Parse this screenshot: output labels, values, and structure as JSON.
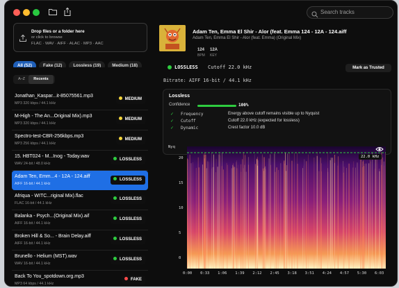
{
  "search": {
    "placeholder": "Search tracks"
  },
  "drop_zone": {
    "line1": "Drop files or a folder here",
    "line2": "or click to browse",
    "line3": "FLAC · WAV · AIFF · ALAC · MP3 · AAC"
  },
  "filters": [
    "All (52)",
    "Fake (12)",
    "Lossless (19)",
    "Medium (18)"
  ],
  "sort": {
    "az": "A–Z",
    "recent": "Recents"
  },
  "colors": {
    "accent": "#1f6fe5",
    "lossless": "#2ecc40",
    "medium": "#f5d63d",
    "fake": "#ff4b4b"
  },
  "tracks": [
    {
      "name": "Jonathan_Kaspar...it-85075561.mp3",
      "meta": "MP3 320 kbps / 44.1 kHz",
      "badge": "MEDIUM",
      "color": "#f5d63d"
    },
    {
      "name": "M-High - The An...Original Mix).mp3",
      "meta": "MP3 320 kbps / 44.1 kHz",
      "badge": "MEDIUM",
      "color": "#f5d63d"
    },
    {
      "name": "Spectro-test-CBR-256kbps.mp3",
      "meta": "MP3 256 kbps / 44.1 kHz",
      "badge": "MEDIUM",
      "color": "#f5d63d"
    },
    {
      "name": "15. HBT024 - M...Inog - Today.wav",
      "meta": "WAV 24-bit / 48.0 kHz",
      "badge": "LOSSLESS",
      "color": "#2ecc40"
    },
    {
      "name": "Adam Ten, Emm...4 - 12A - 124.aiff",
      "meta": "AIFF 16-bit / 44.1 kHz",
      "badge": "LOSSLESS",
      "color": "#2ecc40",
      "selected": true
    },
    {
      "name": "Afriqua - WITC...riginal Mix).flac",
      "meta": "FLAC 16-bit / 44.1 kHz",
      "badge": "LOSSLESS",
      "color": "#2ecc40"
    },
    {
      "name": "Balanka - Psych...(Original Mix).aif",
      "meta": "AIFF 16-bit / 44.1 kHz",
      "badge": "LOSSLESS",
      "color": "#2ecc40"
    },
    {
      "name": "Broken Hill & So... - Brain Delay.aiff",
      "meta": "AIFF 16-bit / 44.1 kHz",
      "badge": "LOSSLESS",
      "color": "#2ecc40"
    },
    {
      "name": "Brunello - Helium (MST).wav",
      "meta": "WAV 16-bit / 44.1 kHz",
      "badge": "LOSSLESS",
      "color": "#2ecc40"
    },
    {
      "name": "Back To You_spotdown.org.mp3",
      "meta": "MP3 64 kbps / 44.1 kHz",
      "badge": "FAKE",
      "color": "#ff4b4b"
    }
  ],
  "detail": {
    "title": "Adam Ten, Emma El Shir - Alor (feat. Emma 124 - 12A - 124.aiff",
    "artist": "Adam Ten, Emma El Shir - Alor (feat. Emma) (Original Mix)",
    "stat1_value": "124",
    "stat1_label": "BPM",
    "stat2_value": "12A",
    "stat2_label": "KEY",
    "verdict": "LOSSLESS",
    "cutoff": "Cutoff 22.0 kHz",
    "mark_button": "Mark as Trusted",
    "bitrate": "Bitrate: AIFF 16-bit / 44.1 kHz",
    "analysis": {
      "title": "Lossless",
      "confidence_label": "Confidence",
      "confidence_value": "100%",
      "confidence": 1.0,
      "checks": [
        {
          "label": "Frequency",
          "value": "Energy above cutoff remains visible up to Nyquist"
        },
        {
          "label": "Cutoff",
          "value": "Cutoff 22.0 kHz (expected for lossless)"
        },
        {
          "label": "Dynamic",
          "value": "Crest factor 10.0 dB"
        }
      ]
    },
    "spectrogram": {
      "y_labels": [
        "Nyq",
        "20",
        "15",
        "10",
        "5",
        "0"
      ],
      "x_labels": [
        "0:00",
        "0:33",
        "1:06",
        "1:39",
        "2:12",
        "2:45",
        "3:18",
        "3:51",
        "4:24",
        "4:57",
        "5:30",
        "6:03"
      ],
      "cutoff_label": "22.0 kHz"
    }
  }
}
